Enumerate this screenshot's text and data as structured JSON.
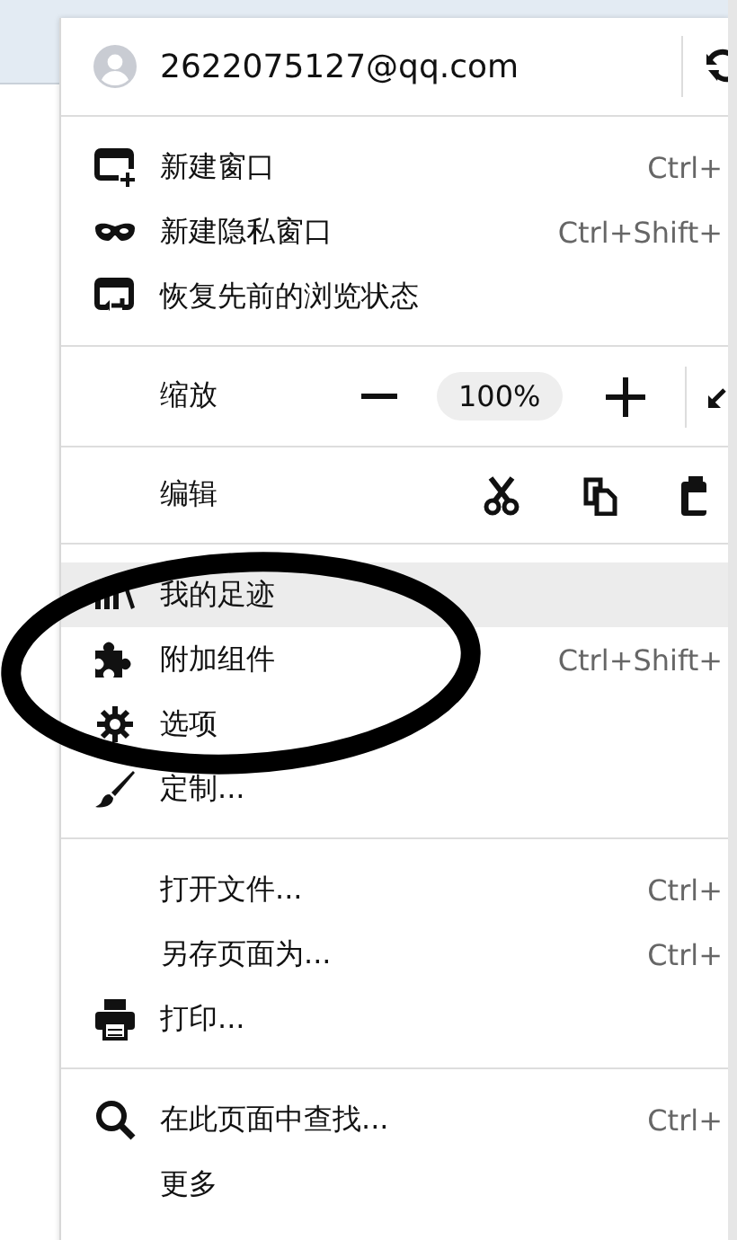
{
  "account": {
    "email": "2622075127@qq.com"
  },
  "groups": [
    {
      "kind": "items",
      "items": [
        {
          "label": "新建窗口",
          "shortcut": "Ctrl+",
          "highlighted": false
        },
        {
          "label": "新建隐私窗口",
          "shortcut": "Ctrl+Shift+",
          "highlighted": false
        },
        {
          "label": "恢复先前的浏览状态",
          "highlighted": false
        }
      ]
    },
    {
      "kind": "zoom",
      "label": "缩放",
      "value": "100%"
    },
    {
      "kind": "edit",
      "label": "编辑"
    },
    {
      "kind": "items",
      "items": [
        {
          "label": "我的足迹",
          "highlighted": true
        },
        {
          "label": "附加组件",
          "shortcut": "Ctrl+Shift+",
          "highlighted": false
        },
        {
          "label": "选项",
          "highlighted": false
        },
        {
          "label": "定制...",
          "highlighted": false
        }
      ]
    },
    {
      "kind": "items",
      "items": [
        {
          "label": "打开文件...",
          "shortcut": "Ctrl+",
          "highlighted": false
        },
        {
          "label": "另存页面为...",
          "shortcut": "Ctrl+",
          "highlighted": false
        },
        {
          "label": "打印...",
          "highlighted": false
        }
      ]
    },
    {
      "kind": "items",
      "items": [
        {
          "label": "在此页面中查找...",
          "shortcut": "Ctrl+",
          "highlighted": false
        },
        {
          "label": "更多",
          "highlighted": false
        }
      ]
    }
  ]
}
